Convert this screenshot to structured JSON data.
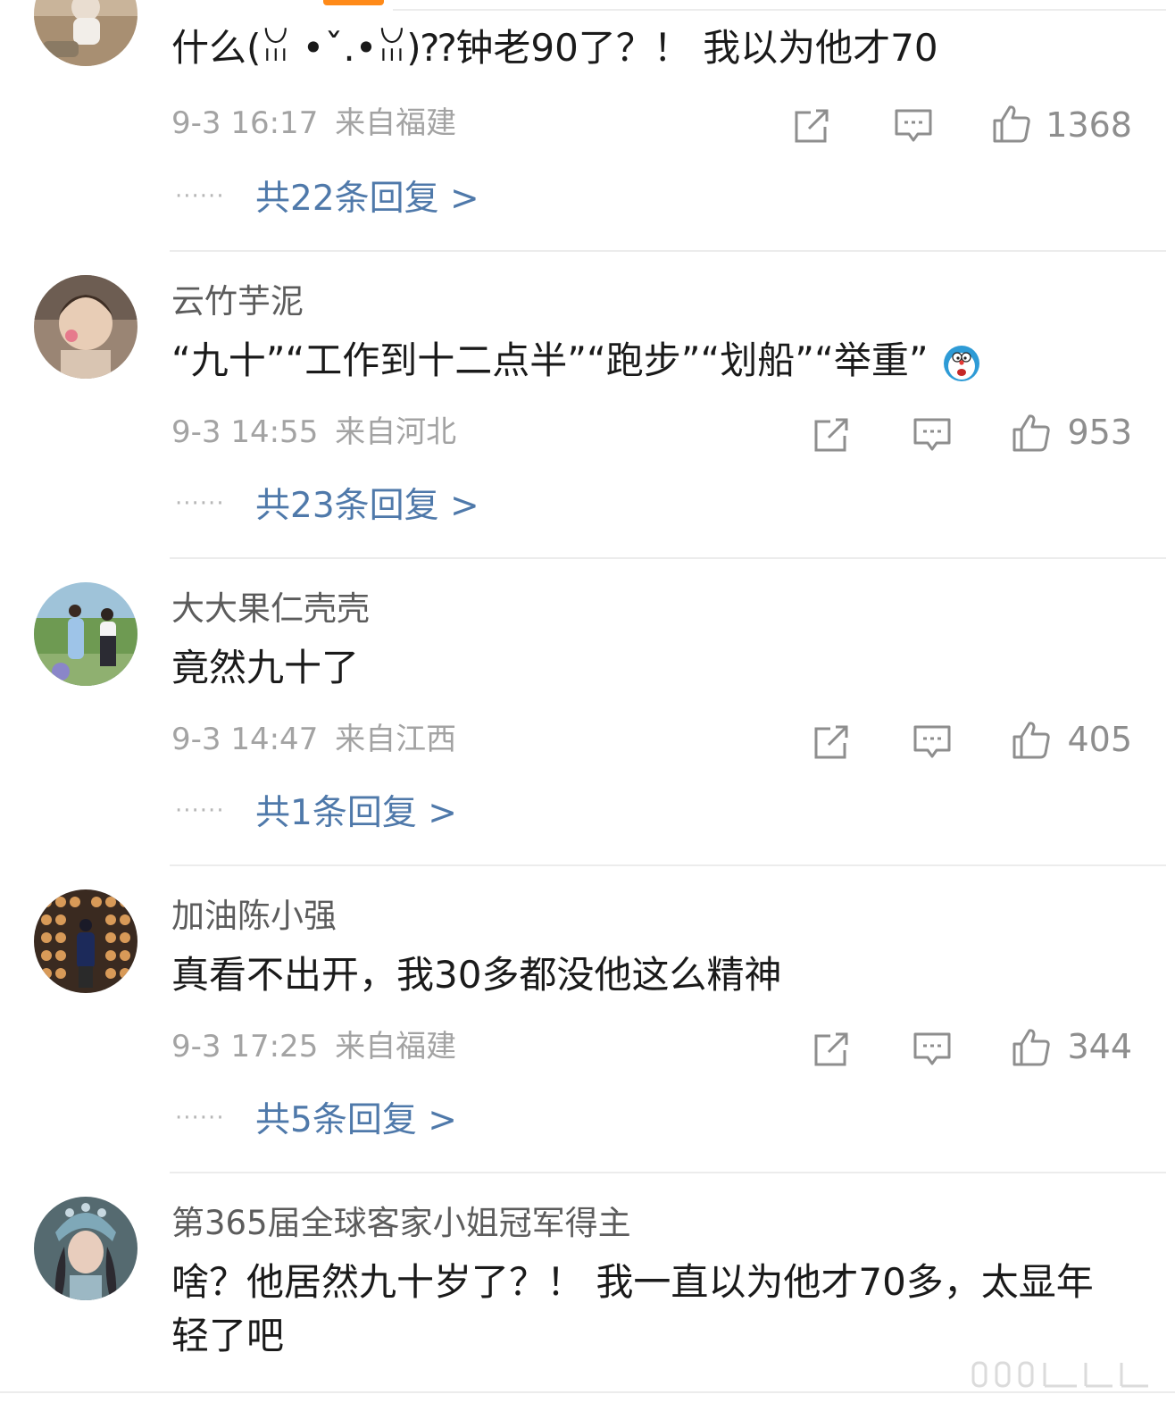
{
  "colors": {
    "username": "#5c5c5c",
    "text": "#1a1a1a",
    "meta": "#a3a3a3",
    "reply_link": "#4f79aa",
    "divider": "#ececec",
    "accent": "#ff8a18"
  },
  "icons": {
    "share": "share-icon",
    "comment": "comment-icon",
    "like": "thumbs-up-icon"
  },
  "comments": [
    {
      "username": "",
      "text": "什么(ꈍ •ˇ.•ꈍ)⁇钟老90了？！ 我以为他才70",
      "time": "9-3 16:17",
      "location": "来自福建",
      "likes": "1368",
      "dots": "······",
      "replies": "共22条回复 >"
    },
    {
      "username": "云竹芋泥",
      "text": "“九十”“工作到十二点半”“跑步”“划船”“举重”",
      "time": "9-3 14:55",
      "location": "来自河北",
      "likes": "953",
      "dots": "······",
      "replies": "共23条回复 >"
    },
    {
      "username": "大大果仁壳壳",
      "text": "竟然九十了",
      "time": "9-3 14:47",
      "location": "来自江西",
      "likes": "405",
      "dots": "······",
      "replies": "共1条回复 >"
    },
    {
      "username": "加油陈小强",
      "text": "真看不出开，我30多都没他这么精神",
      "time": "9-3 17:25",
      "location": "来自福建",
      "likes": "344",
      "dots": "······",
      "replies": "共5条回复 >"
    },
    {
      "username": "第365届全球客家小姐冠军得主",
      "text": "啥？他居然九十岁了？！ 我一直以为他才70多，太显年轻了吧",
      "time": "",
      "location": "",
      "likes": "",
      "dots": "",
      "replies": ""
    }
  ]
}
